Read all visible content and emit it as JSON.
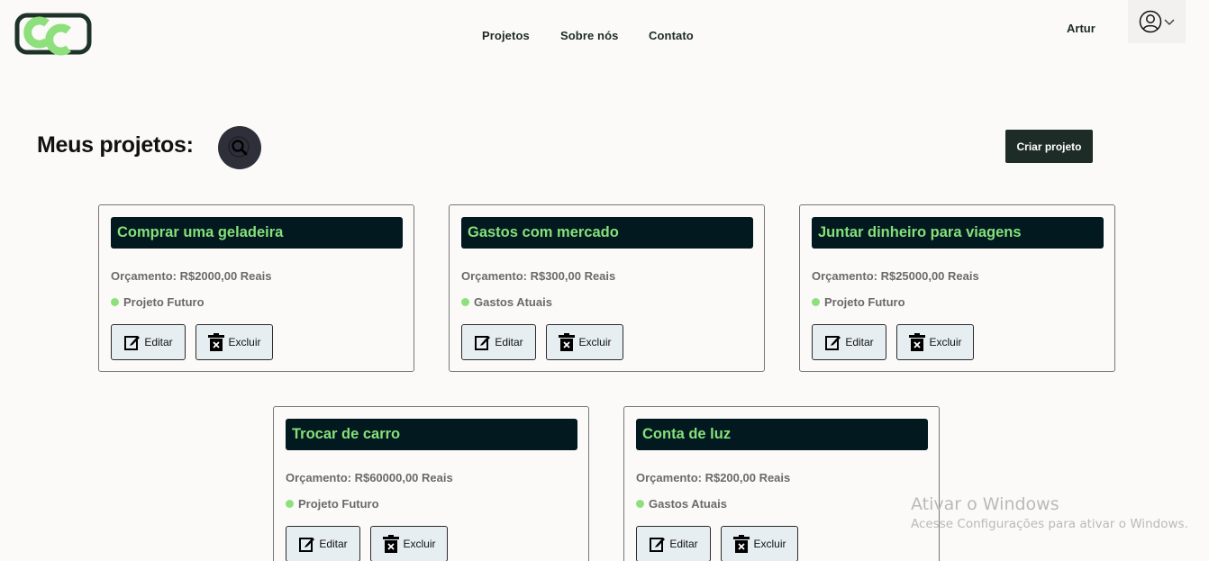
{
  "header": {
    "nav": [
      {
        "label": "Projetos"
      },
      {
        "label": "Sobre nós"
      },
      {
        "label": "Contato"
      }
    ],
    "user_name": "Artur",
    "logo_icon": "cc-logo-icon",
    "user_icon": "user-circle-icon",
    "dropdown_icon": "chevron-down-icon"
  },
  "main": {
    "title": "Meus projetos:",
    "search_icon": "search-icon",
    "create_button": "Criar projeto"
  },
  "projects": [
    {
      "title": "Comprar uma geladeira",
      "budget": "Orçamento: R$2000,00 Reais",
      "status": "Projeto Futuro",
      "edit": "Editar",
      "delete": "Excluir"
    },
    {
      "title": "Gastos com mercado",
      "budget": "Orçamento: R$300,00 Reais",
      "status": "Gastos Atuais",
      "edit": "Editar",
      "delete": "Excluir"
    },
    {
      "title": "Juntar dinheiro para viagens",
      "budget": "Orçamento: R$25000,00 Reais",
      "status": "Projeto Futuro",
      "edit": "Editar",
      "delete": "Excluir"
    },
    {
      "title": "Trocar de carro",
      "budget": "Orçamento: R$60000,00 Reais",
      "status": "Projeto Futuro",
      "edit": "Editar",
      "delete": "Excluir"
    },
    {
      "title": "Conta de luz",
      "budget": "Orçamento: R$200,00 Reais",
      "status": "Gastos Atuais",
      "edit": "Editar",
      "delete": "Excluir"
    }
  ],
  "colors": {
    "accent_green": "#86e07a",
    "card_title_bg": "#021920",
    "primary_button": "#1e2c28",
    "status_dot": "#8ee07c"
  },
  "watermark": {
    "line1": "Ativar o Windows",
    "line2": "Acesse Configurações para ativar o Windows."
  }
}
